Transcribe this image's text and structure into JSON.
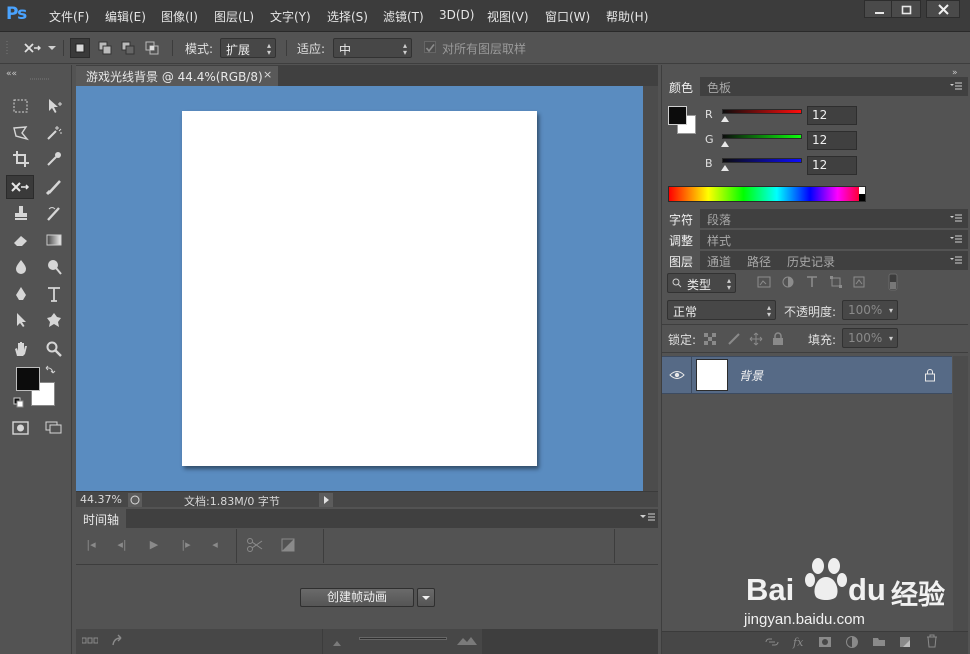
{
  "app": {
    "logo": "Ps"
  },
  "menu": [
    "文件(F)",
    "编辑(E)",
    "图像(I)",
    "图层(L)",
    "文字(Y)",
    "选择(S)",
    "滤镜(T)",
    "3D(D)",
    "视图(V)",
    "窗口(W)",
    "帮助(H)"
  ],
  "options": {
    "mode_label": "模式:",
    "mode_value": "扩展",
    "adapt_label": "适应:",
    "adapt_value": "中",
    "sample_all_label": "对所有图层取样"
  },
  "document": {
    "tab_title": "游戏光线背景 @ 44.4%(RGB/8)",
    "zoom": "44.37%",
    "doc_info": "文档:1.83M/0 字节",
    "canvas_bg": "#5a8cc0"
  },
  "timeline": {
    "tab": "时间轴",
    "create_button": "创建帧动画"
  },
  "color_panel": {
    "tabs": [
      "颜色",
      "色板"
    ],
    "channels": [
      {
        "label": "R",
        "value": "12"
      },
      {
        "label": "G",
        "value": "12"
      },
      {
        "label": "B",
        "value": "12"
      }
    ]
  },
  "char_panel": {
    "tabs": [
      "字符",
      "段落"
    ]
  },
  "adjust_panel": {
    "tabs": [
      "调整",
      "样式"
    ]
  },
  "layers_panel": {
    "tabs": [
      "图层",
      "通道",
      "路径",
      "历史记录"
    ],
    "filter_label": "类型",
    "blend_mode": "正常",
    "opacity_label": "不透明度:",
    "opacity_value": "100%",
    "lock_label": "锁定:",
    "fill_label": "填充:",
    "fill_value": "100%",
    "layers": [
      {
        "name": "背景"
      }
    ]
  },
  "watermark": {
    "brand": "Bai",
    "brand2": "du",
    "cn": "经验",
    "url": "jingyan.baidu.com"
  },
  "colors": {
    "accent_blue": "#4aa3ff",
    "selected_layer": "#566a86"
  }
}
